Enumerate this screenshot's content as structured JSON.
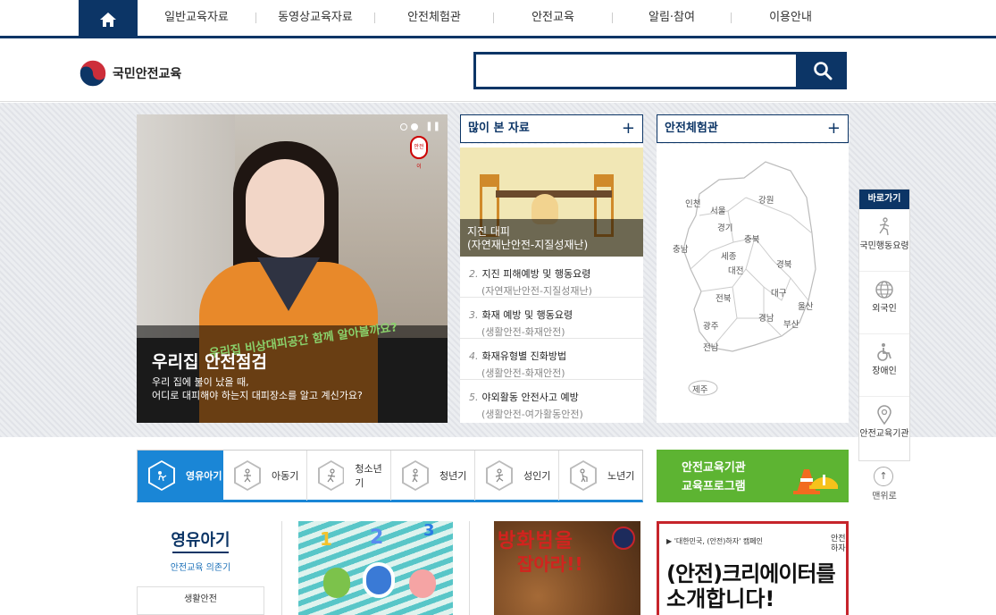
{
  "nav": {
    "items": [
      "일반교육자료",
      "동영상교육자료",
      "안전체험관",
      "안전교육",
      "알림·참여",
      "이용안내"
    ]
  },
  "header": {
    "logo_text": "국민안전교육",
    "search_placeholder": ""
  },
  "banner": {
    "title": "우리집 안전점검",
    "sub1": "우리 집에 불이 났을 때,",
    "sub2": "어디로 대피해야 하는지 대피장소를 알고 계신가요?",
    "overlay_text": "우리집 비상대피공간 함께 알아볼까요?",
    "mascot": "안전이"
  },
  "mostview": {
    "title": "많이 본 자료",
    "plus": "+",
    "feature_title": "지진 대피",
    "feature_sub": "(자연재난안전-지질성재난)",
    "items": [
      {
        "num": "2.",
        "title": "지진 피해예방 및 행동요령",
        "sub": "(자연재난안전-지질성재난)"
      },
      {
        "num": "3.",
        "title": "화재 예방 및 행동요령",
        "sub": "(생활안전-화재안전)"
      },
      {
        "num": "4.",
        "title": "화재유형별 진화방법",
        "sub": "(생활안전-화재안전)"
      },
      {
        "num": "5.",
        "title": "야외활동 안전사고 예방",
        "sub": "(생활안전-여가활동안전)"
      }
    ]
  },
  "map": {
    "title": "안전체험관",
    "plus": "+",
    "regions": [
      "인천",
      "서울",
      "강원",
      "경기",
      "충북",
      "충남",
      "세종",
      "대전",
      "경북",
      "대구",
      "전북",
      "울산",
      "경남",
      "광주",
      "부산",
      "전남",
      "제주"
    ]
  },
  "quick": {
    "title": "바로가기",
    "items": [
      "국민행동요령",
      "외국인",
      "장애인",
      "안전교육기관"
    ],
    "totop": "맨위로"
  },
  "ages": [
    "영유아기",
    "아동기",
    "청소년기",
    "청년기",
    "성인기",
    "노년기"
  ],
  "institution": {
    "line1": "안전교육기관",
    "line2": "교육프로그램"
  },
  "side": {
    "title": "영유아기",
    "sub": "안전교육 의존기",
    "box": "생활안전"
  },
  "cards": {
    "c2_line1": "방화범을",
    "c2_line2": "잡아라!!",
    "c3_top": "▶ '대한민국, (안전)하자' 캠페인",
    "c3_big1": "(안전)크리에이터를",
    "c3_big2": "소개합니다!",
    "c3_corner": "안전하자"
  },
  "colors": {
    "brand_navy": "#0c3566",
    "age_active": "#1a86d6",
    "institution_green": "#5db432",
    "card_red": "#c6242b"
  }
}
